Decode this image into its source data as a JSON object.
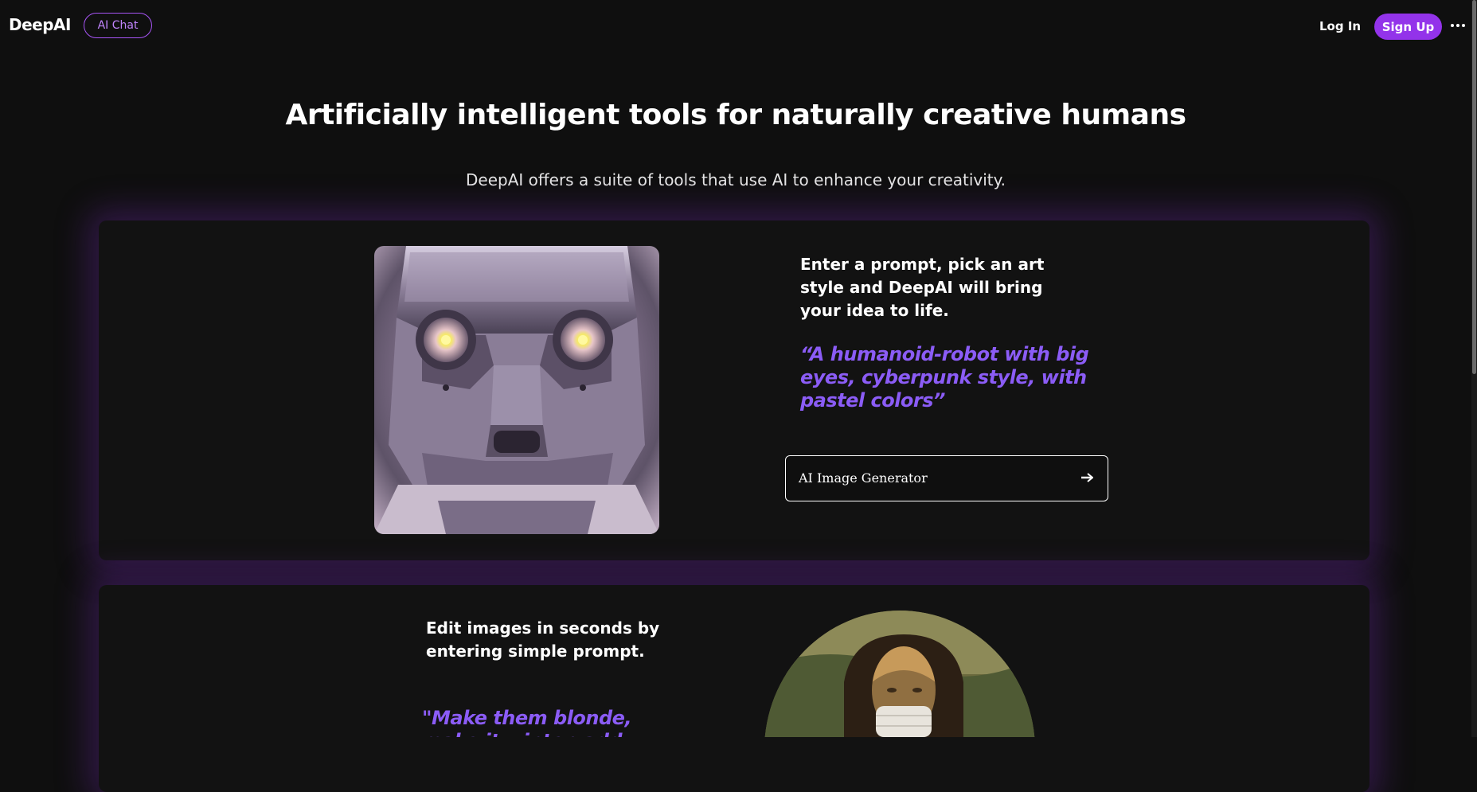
{
  "header": {
    "logo": "DeepAI",
    "chat_button": "AI Chat",
    "login": "Log In",
    "signup": "Sign Up",
    "more_icon": "more-dots-icon"
  },
  "hero": {
    "title": "Artificially intelligent tools for naturally creative humans",
    "subtitle": "DeepAI offers a suite of tools that use AI to enhance your creativity."
  },
  "card1": {
    "image": "robot-face-image",
    "description": "Enter a prompt, pick an art style and DeepAI will bring your idea to life.",
    "quote": "“A humanoid-robot with big eyes, cyberpunk style, with pastel colors”",
    "button_label": "AI Image Generator",
    "button_icon": "arrow-right-icon"
  },
  "card2": {
    "description": "Edit images in seconds by entering simple prompt.",
    "quote": "\"Make them blonde, make it winter, add volcano to the",
    "image": "mona-lisa-image"
  },
  "colors": {
    "accent": "#9333ea",
    "accent_text": "#8b5cf6",
    "background": "#0f0f0f",
    "card": "#121212"
  }
}
